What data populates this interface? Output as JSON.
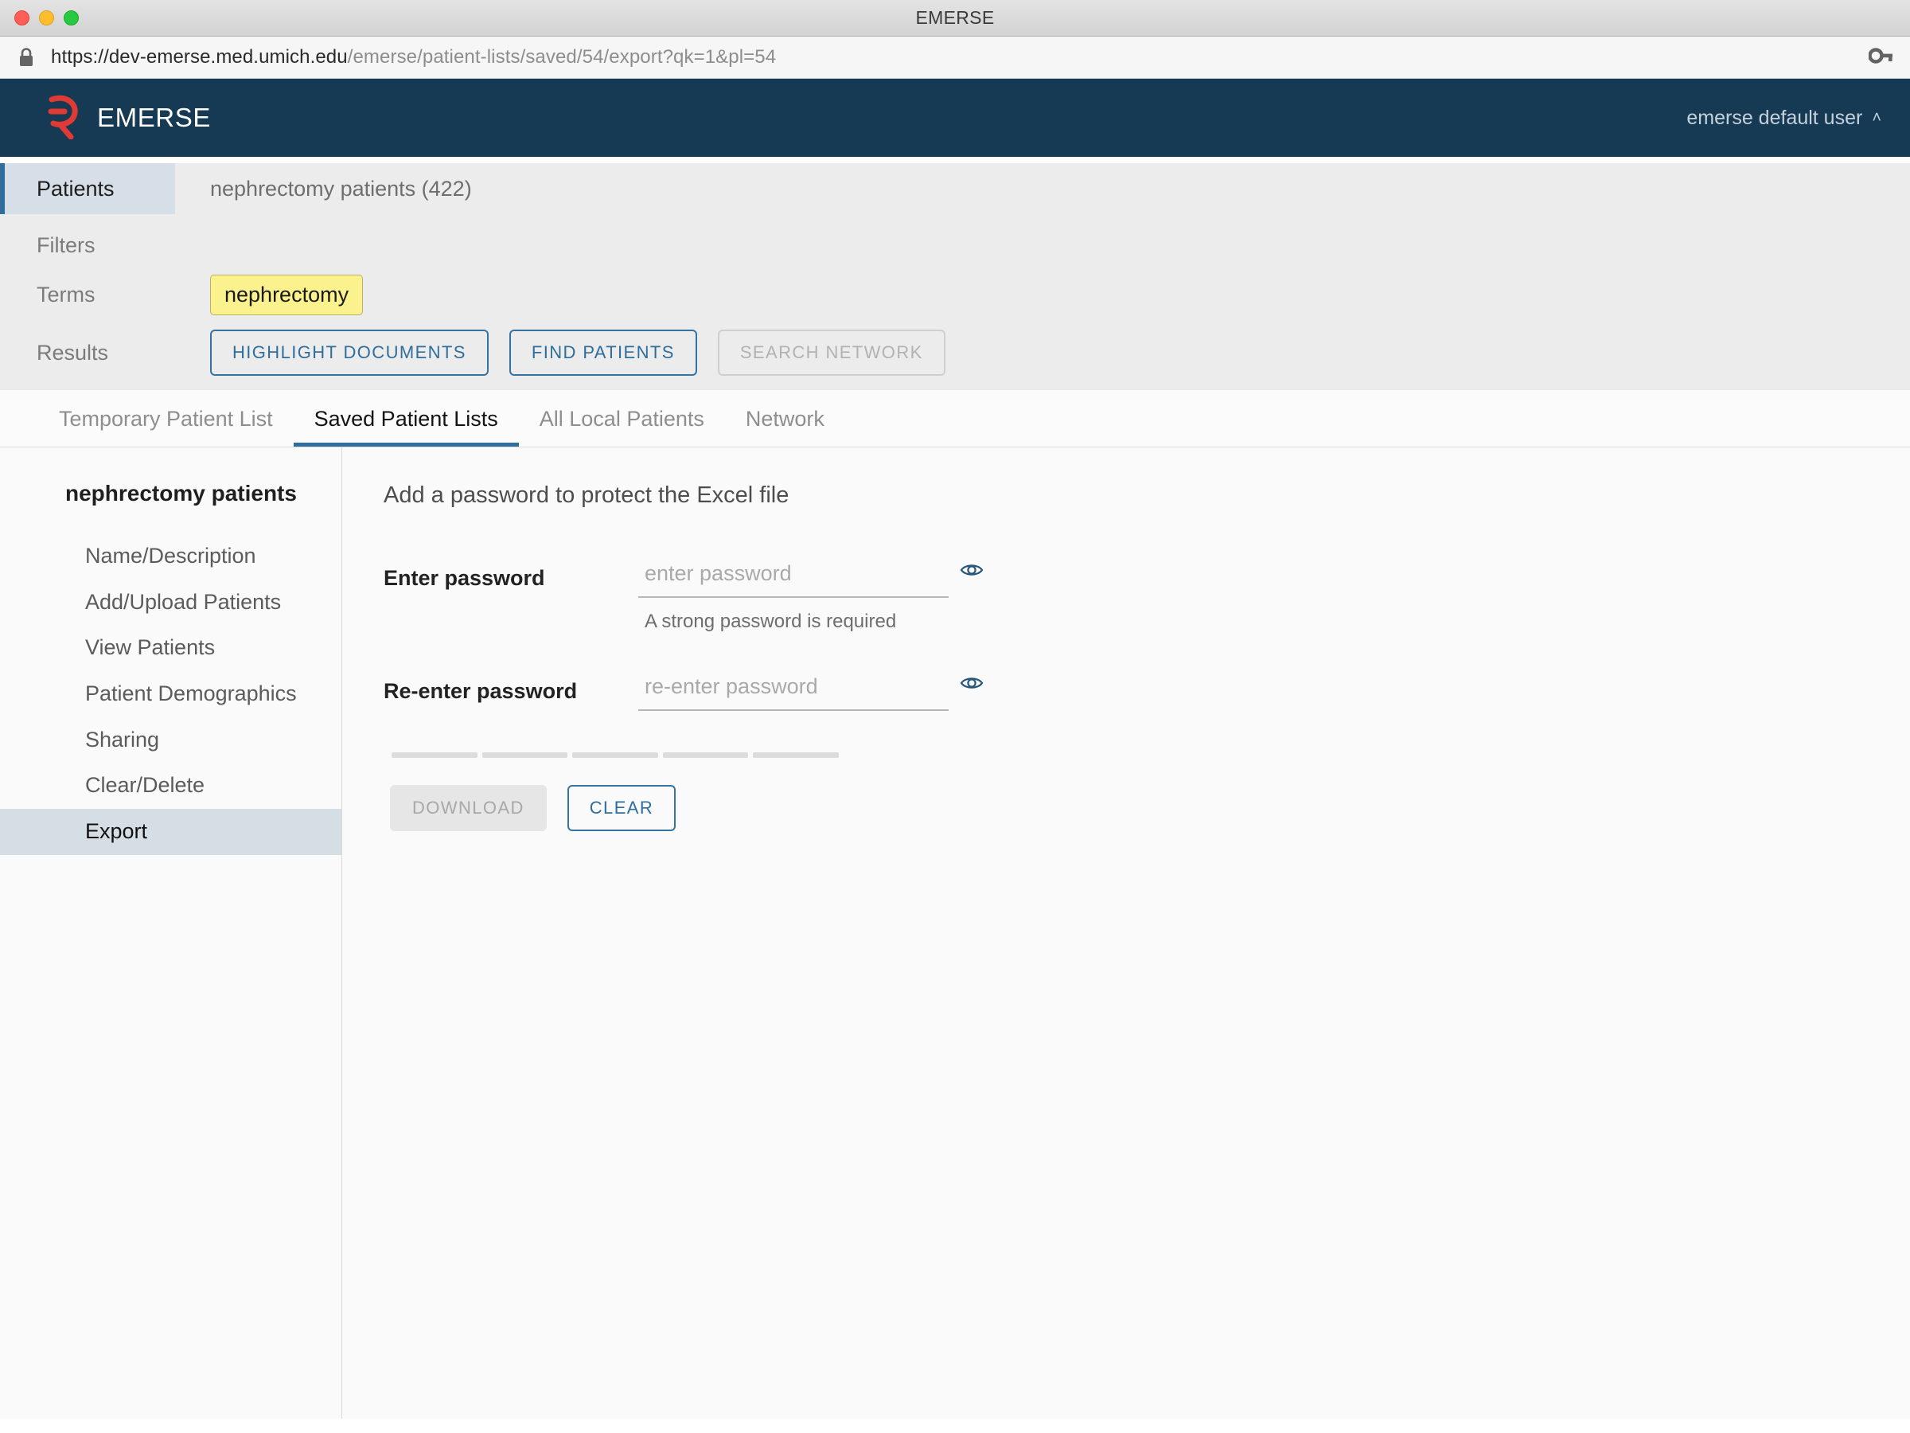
{
  "window": {
    "title": "EMERSE",
    "traffic_lights": [
      "close-button",
      "minimize-button",
      "zoom-button"
    ]
  },
  "urlbar": {
    "lock_icon": "lock-icon",
    "url_secure": "https://dev-emerse.med.umich.edu",
    "url_path": "/emerse/patient-lists/saved/54/export?qk=1&pl=54",
    "key_icon": "key-icon"
  },
  "app_header": {
    "logo_icon": "emerse-logo-icon",
    "brand": "EMERSE",
    "user": "emerse default user",
    "caret": "˄"
  },
  "query_panel": {
    "rows": [
      {
        "label": "Patients",
        "value": "nephrectomy patients (422)"
      },
      {
        "label": "Filters",
        "value": ""
      },
      {
        "label": "Terms",
        "value": ""
      },
      {
        "label": "Results",
        "value": ""
      }
    ],
    "term_chip": "nephrectomy",
    "buttons": [
      {
        "label": "HIGHLIGHT DOCUMENTS",
        "state": "enabled"
      },
      {
        "label": "FIND PATIENTS",
        "state": "enabled"
      },
      {
        "label": "SEARCH NETWORK",
        "state": "disabled"
      }
    ]
  },
  "tabs": [
    {
      "label": "Temporary Patient List",
      "selected": false
    },
    {
      "label": "Saved Patient Lists",
      "selected": true
    },
    {
      "label": "All Local Patients",
      "selected": false
    },
    {
      "label": "Network",
      "selected": false
    }
  ],
  "sidebar": {
    "title": "nephrectomy patients",
    "items": [
      {
        "label": "Name/Description",
        "selected": false
      },
      {
        "label": "Add/Upload Patients",
        "selected": false
      },
      {
        "label": "View Patients",
        "selected": false
      },
      {
        "label": "Patient Demographics",
        "selected": false
      },
      {
        "label": "Sharing",
        "selected": false
      },
      {
        "label": "Clear/Delete",
        "selected": false
      },
      {
        "label": "Export",
        "selected": true
      }
    ]
  },
  "export_panel": {
    "title": "Add a password to protect the Excel file",
    "enter_password": {
      "label": "Enter password",
      "value": "",
      "placeholder": "enter password",
      "hint": "A strong password is required",
      "toggle_icon": "eye-icon"
    },
    "reenter_password": {
      "label": "Re-enter password",
      "value": "",
      "placeholder": "re-enter password",
      "toggle_icon": "eye-icon"
    },
    "strength_segments": 5,
    "strength_filled": 0,
    "buttons": [
      {
        "label": "DOWNLOAD",
        "state": "disabled"
      },
      {
        "label": "CLEAR",
        "state": "enabled"
      }
    ]
  },
  "colors": {
    "header_navy": "#163a54",
    "logo_red": "#e03a34",
    "accent_blue": "#2e6d9c",
    "active_row_bg": "#d6dfe8",
    "term_highlight": "#fbf28d",
    "panel_bg": "#fafafa"
  }
}
